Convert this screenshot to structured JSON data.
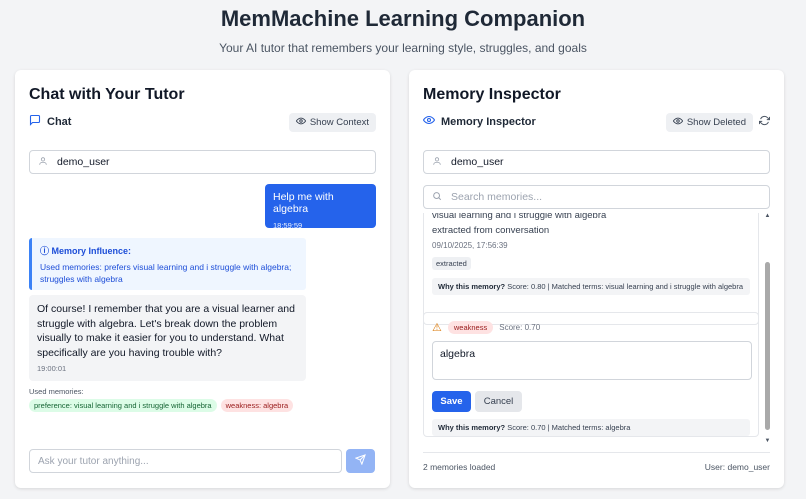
{
  "header": {
    "title": "MemMachine Learning Companion",
    "subtitle": "Your AI tutor that remembers your learning style, struggles, and goals"
  },
  "chat": {
    "title": "Chat with Your Tutor",
    "tab_label": "Chat",
    "show_context_label": "Show Context",
    "user_field_value": "demo_user",
    "messages": [
      {
        "role": "user",
        "text": "Help me with algebra",
        "time": "18:59:59"
      },
      {
        "role": "assistant",
        "text": "Of course! I remember that you are a visual learner and struggle with algebra. Let's break down the problem visually to make it easier for you to understand. What specifically are you having trouble with?",
        "time": "19:00:01"
      }
    ],
    "memory_influence": {
      "title": "Memory Influence:",
      "body": "Used memories: prefers visual learning and i struggle with algebra; struggles with algebra"
    },
    "used_memories_label": "Used memories:",
    "used_memories": [
      {
        "label": "preference: visual learning and i struggle with algebra",
        "color": "#dcfce7"
      },
      {
        "label": "weakness: algebra",
        "color": "#fee2e2"
      }
    ],
    "input_placeholder": "Ask your tutor anything...",
    "send_icon": "send-icon"
  },
  "inspector": {
    "title": "Memory Inspector",
    "tab_label": "Memory Inspector",
    "show_deleted_label": "Show Deleted",
    "user_field_value": "demo_user",
    "search_placeholder": "Search memories...",
    "memories": [
      {
        "text": "visual learning and i struggle with algebra",
        "source": "extracted from conversation",
        "date": "09/10/2025, 17:56:39",
        "tag": "extracted",
        "why_label": "Why this memory?",
        "why_text": "Score: 0.80 | Matched terms: visual learning and i struggle with algebra"
      },
      {
        "type": "weakness",
        "score": "Score: 0.70",
        "edit_value": "algebra",
        "save_label": "Save",
        "cancel_label": "Cancel",
        "why_label": "Why this memory?",
        "why_text": "Score: 0.70 | Matched terms: algebra"
      }
    ],
    "footer_count": "2 memories loaded",
    "footer_user": "User: demo_user"
  }
}
